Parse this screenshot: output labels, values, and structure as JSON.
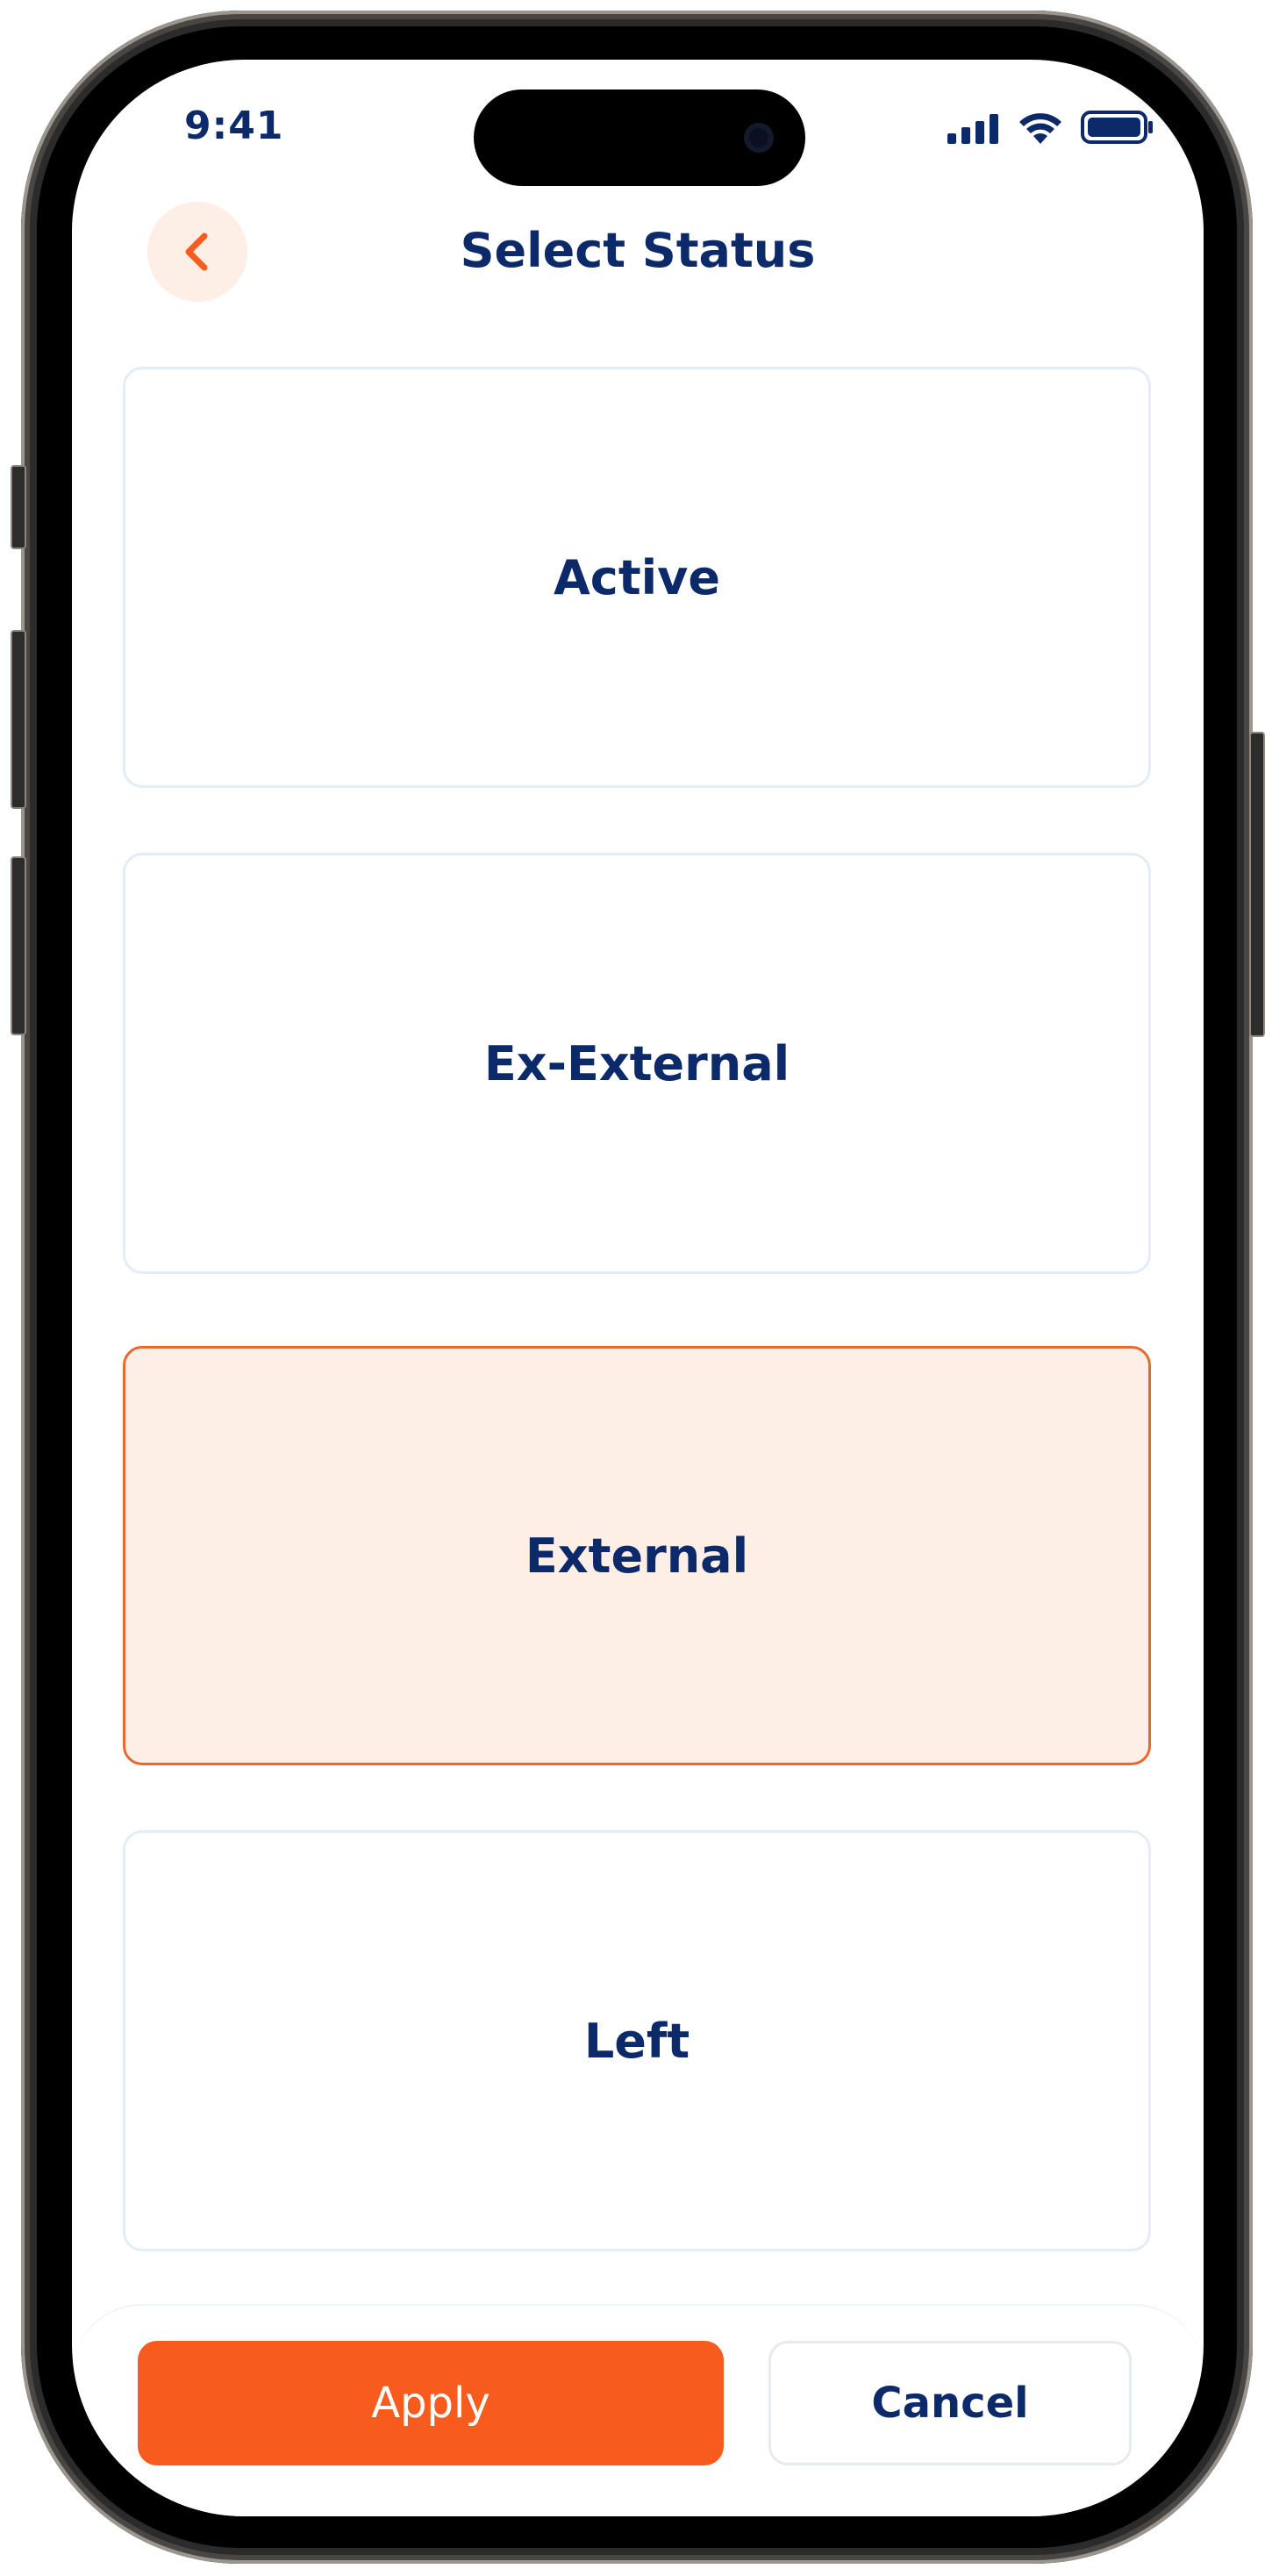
{
  "status_bar": {
    "time": "9:41"
  },
  "header": {
    "title": "Select Status",
    "back_icon": "chevron-left-icon"
  },
  "options": [
    {
      "label": "Active",
      "selected": false
    },
    {
      "label": "Ex-External",
      "selected": false
    },
    {
      "label": "External",
      "selected": true
    },
    {
      "label": "Left",
      "selected": false
    }
  ],
  "actions": {
    "apply_label": "Apply",
    "cancel_label": "Cancel"
  },
  "colors": {
    "primary_text": "#0c2a6a",
    "accent": "#f75c1e",
    "accent_soft": "#fdeee6",
    "border": "#e3edf7"
  }
}
